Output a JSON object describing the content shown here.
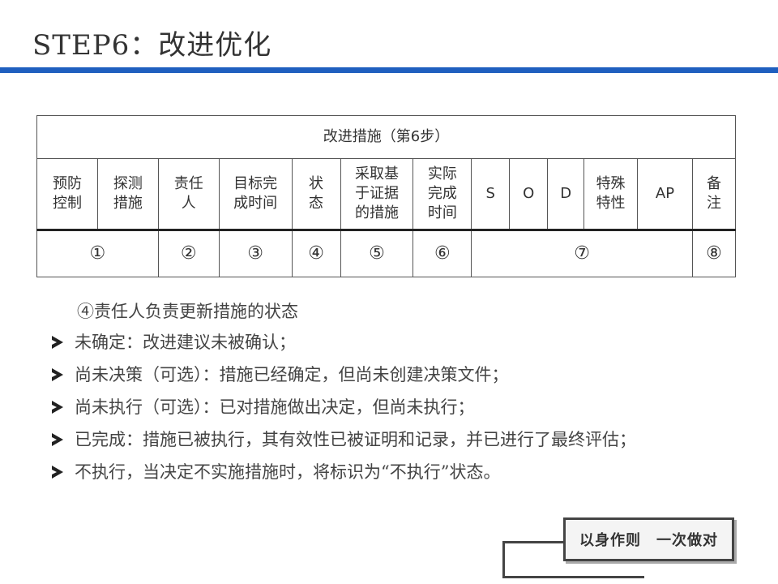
{
  "title": "STEP6：改进优化",
  "table": {
    "header": "改进措施（第6步）",
    "columns": [
      "预防\n控制",
      "探测\n措施",
      "责任\n人",
      "目标完\n成时间",
      "状\n态",
      "采取基\n于证据\n的措施",
      "实际\n完成\n时间",
      "S",
      "O",
      "D",
      "特殊\n特性",
      "AP",
      "备\n注"
    ],
    "numbers": [
      "①",
      "②",
      "③",
      "④",
      "⑤",
      "⑥",
      "⑦",
      "⑧"
    ]
  },
  "intro": "④责任人负责更新措施的状态",
  "bullets": [
    "未确定：改进建议未被确认；",
    "尚未决策（可选）：措施已经确定，但尚未创建决策文件；",
    "尚未执行（可选）：已对措施做出决定，但尚未执行；",
    "已完成：措施已被执行，其有效性已被证明和记录，并已进行了最终评估；",
    "不执行，当决定不实施措施时，将标识为“不执行”状态。"
  ],
  "stamp": "以身作则　一次做对"
}
